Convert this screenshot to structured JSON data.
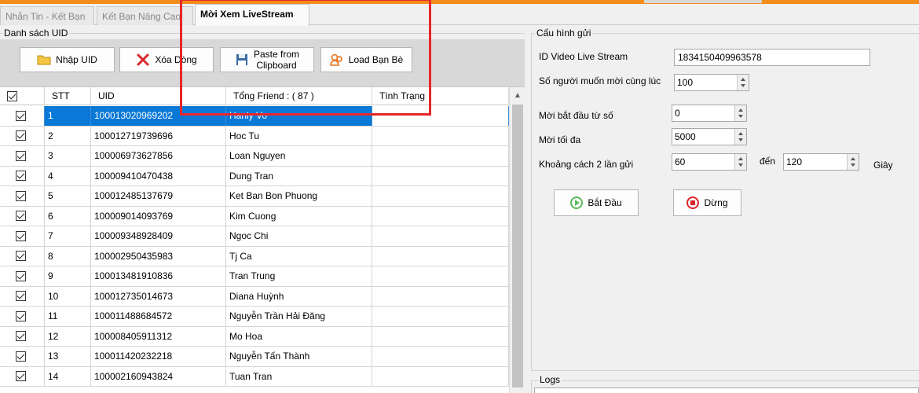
{
  "tabs": [
    {
      "label": "Nhắn Tin - Kết Bạn"
    },
    {
      "label": "Kết Bạn Nâng Cao"
    },
    {
      "label": "Mời Xem LiveStream"
    }
  ],
  "left_group": {
    "title": "Danh sách UID",
    "buttons": {
      "import": "Nhập UID",
      "delete": "Xóa Dòng",
      "paste_line1": "Paste from",
      "paste_line2": "Clipboard",
      "load": "Load Bạn Bè"
    },
    "columns": {
      "stt": "STT",
      "uid": "UID",
      "friends": "Tổng Friend : ( 87 )",
      "status": "Tình Trạng"
    },
    "rows": [
      {
        "stt": "1",
        "uid": "100013020969202",
        "name": "Hanly Vo",
        "status": ""
      },
      {
        "stt": "2",
        "uid": "100012719739696",
        "name": "Hoc Tu",
        "status": ""
      },
      {
        "stt": "3",
        "uid": "100006973627856",
        "name": "Loan Nguyen",
        "status": ""
      },
      {
        "stt": "4",
        "uid": "100009410470438",
        "name": "Dung Tran",
        "status": ""
      },
      {
        "stt": "5",
        "uid": "100012485137679",
        "name": "Ket Ban Bon Phuong",
        "status": ""
      },
      {
        "stt": "6",
        "uid": "100009014093769",
        "name": "Kim Cuong",
        "status": ""
      },
      {
        "stt": "7",
        "uid": "100009348928409",
        "name": "Ngoc Chi",
        "status": ""
      },
      {
        "stt": "8",
        "uid": "100002950435983",
        "name": "Tj Ca",
        "status": ""
      },
      {
        "stt": "9",
        "uid": "100013481910836",
        "name": "Tran Trung",
        "status": ""
      },
      {
        "stt": "10",
        "uid": "100012735014673",
        "name": "Diana Huỳnh",
        "status": ""
      },
      {
        "stt": "11",
        "uid": "100011488684572",
        "name": "Nguyễn Trần Hải Đăng",
        "status": ""
      },
      {
        "stt": "12",
        "uid": "100008405911312",
        "name": "Mo Hoa",
        "status": ""
      },
      {
        "stt": "13",
        "uid": "100011420232218",
        "name": "Nguyễn Tấn Thành",
        "status": ""
      },
      {
        "stt": "14",
        "uid": "100002160943824",
        "name": "Tuan Tran",
        "status": ""
      }
    ],
    "selected_row": 1
  },
  "config": {
    "title": "Cấu hình gửi",
    "video_id_label": "ID Video Live Stream",
    "video_id_value": "1834150409963578",
    "invite_count_label": "Số người muốn mời cùng lúc",
    "invite_count_value": "100",
    "start_from_label": "Mời bắt đầu từ số",
    "start_from_value": "0",
    "max_label": "Mời tối đa",
    "max_value": "5000",
    "interval_label": "Khoảng cách 2 lần gửi",
    "interval_min": "60",
    "interval_to_label": "đến",
    "interval_max": "120",
    "interval_unit": "Giây",
    "start_button": "Bắt Đầu",
    "stop_button": "Dừng"
  },
  "logs": {
    "title": "Logs"
  },
  "colors": {
    "accent_bar": "#f28c1a",
    "selection": "#0a78d7",
    "highlight_box": "#e8262b"
  }
}
